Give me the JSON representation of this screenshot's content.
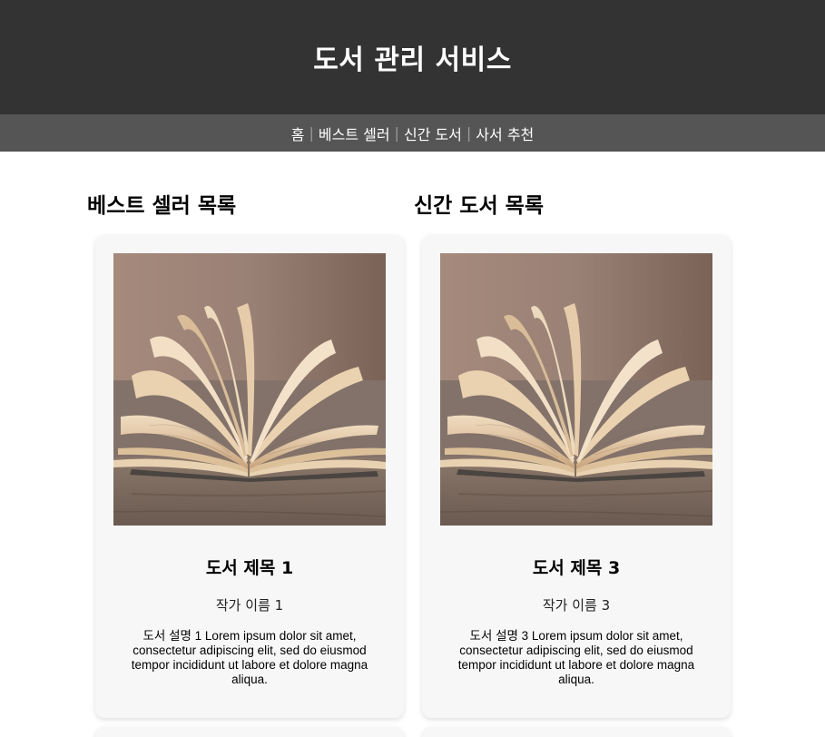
{
  "header": {
    "title": "도서 관리 서비스"
  },
  "nav": {
    "items": [
      {
        "label": "홈"
      },
      {
        "label": "베스트 셀러"
      },
      {
        "label": "신간 도서"
      },
      {
        "label": "사서 추천"
      }
    ],
    "separator": "|"
  },
  "sections": [
    {
      "title": "베스트 셀러 목록",
      "books": [
        {
          "title": "도서 제목 1",
          "author": "작가 이름 1",
          "description": "도서 설명 1 Lorem ipsum dolor sit amet, consectetur adipiscing elit, sed do eiusmod tempor incididunt ut labore et dolore magna aliqua."
        }
      ]
    },
    {
      "title": "신간 도서 목록",
      "books": [
        {
          "title": "도서 제목 3",
          "author": "작가 이름 3",
          "description": "도서 설명 3 Lorem ipsum dolor sit amet, consectetur adipiscing elit, sed do eiusmod tempor incididunt ut labore et dolore magna aliqua."
        }
      ]
    }
  ],
  "colors": {
    "header_bg": "#333333",
    "nav_bg": "#555555",
    "card_bg": "#f7f7f7"
  }
}
